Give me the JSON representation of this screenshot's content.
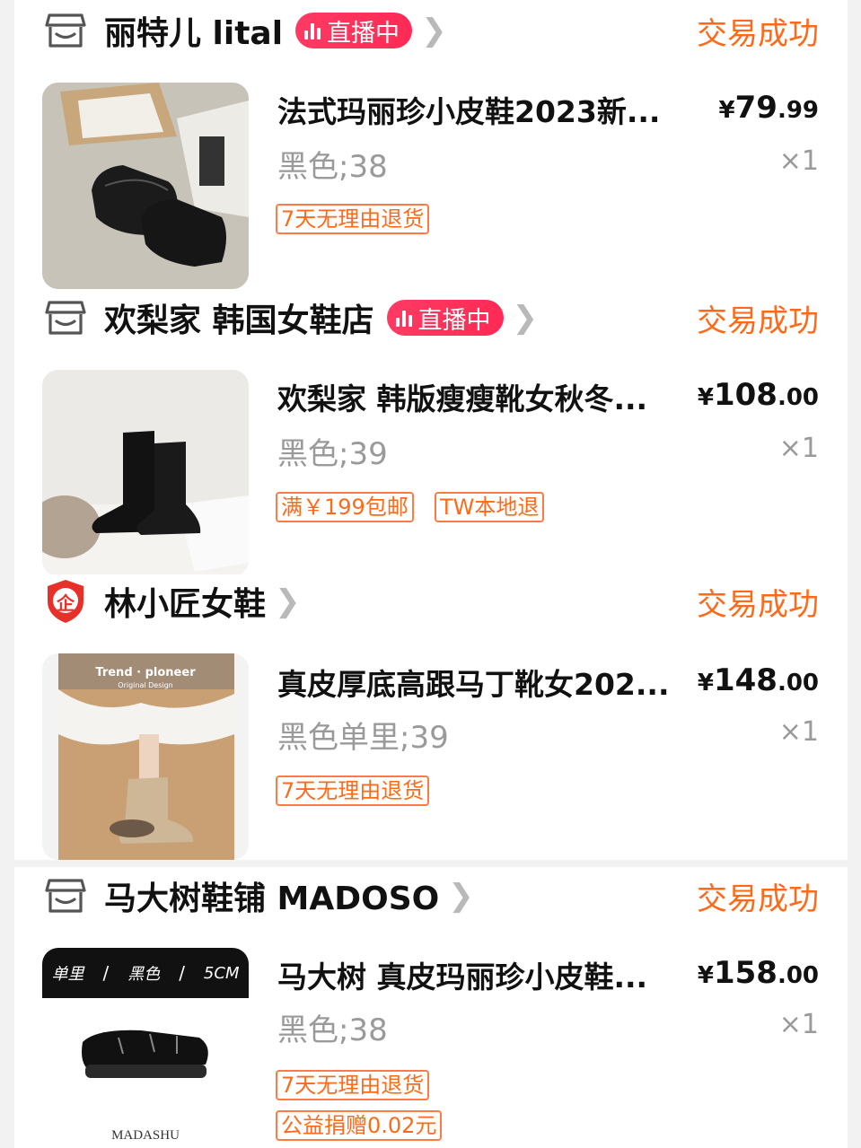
{
  "colors": {
    "accent": "#ff6a1a",
    "live": "#ff2a55",
    "muted": "#9a9a9a"
  },
  "orders": [
    {
      "shop": {
        "name": "丽特儿 lital",
        "icon": "store-icon",
        "live": true,
        "live_label": "直播中"
      },
      "status": "交易成功",
      "item": {
        "title": "法式玛丽珍小皮鞋2023新...",
        "price_symbol": "¥",
        "price_int": "79",
        "price_dec": ".99",
        "sku": "黑色;38",
        "qty": "×1",
        "tags": [
          "7天无理由退货"
        ]
      }
    },
    {
      "shop": {
        "name": "欢梨家 韩国女鞋店",
        "icon": "store-icon",
        "live": true,
        "live_label": "直播中"
      },
      "status": "交易成功",
      "item": {
        "title": "欢梨家 韩版瘦瘦靴女秋冬...",
        "price_symbol": "¥",
        "price_int": "108",
        "price_dec": ".00",
        "sku": "黑色;39",
        "qty": "×1",
        "tags": [
          "满￥199包邮",
          "TW本地退"
        ]
      }
    },
    {
      "shop": {
        "name": "林小匠女鞋",
        "icon": "enterprise-badge-icon",
        "badge_text": "企",
        "live": false
      },
      "status": "交易成功",
      "item": {
        "title": "真皮厚底高跟马丁靴女202...",
        "price_symbol": "¥",
        "price_int": "148",
        "price_dec": ".00",
        "sku": "黑色单里;39",
        "qty": "×1",
        "tags": [
          "7天无理由退货"
        ],
        "image_text": {
          "brand": "Trend · ploneer",
          "sub": "Original Design"
        }
      }
    },
    {
      "shop": {
        "name": "马大树鞋铺 MADOSO",
        "icon": "store-icon",
        "live": false
      },
      "status": "交易成功",
      "item": {
        "title": "马大树 真皮玛丽珍小皮鞋...",
        "price_symbol": "¥",
        "price_int": "158",
        "price_dec": ".00",
        "sku": "黑色;38",
        "qty": "×1",
        "tags": [
          "7天无理由退货",
          "公益捐赠0.02元"
        ],
        "image_text": {
          "banner": [
            "单里",
            "黑色",
            "5CM"
          ],
          "brand": "MADASHU"
        }
      }
    }
  ]
}
